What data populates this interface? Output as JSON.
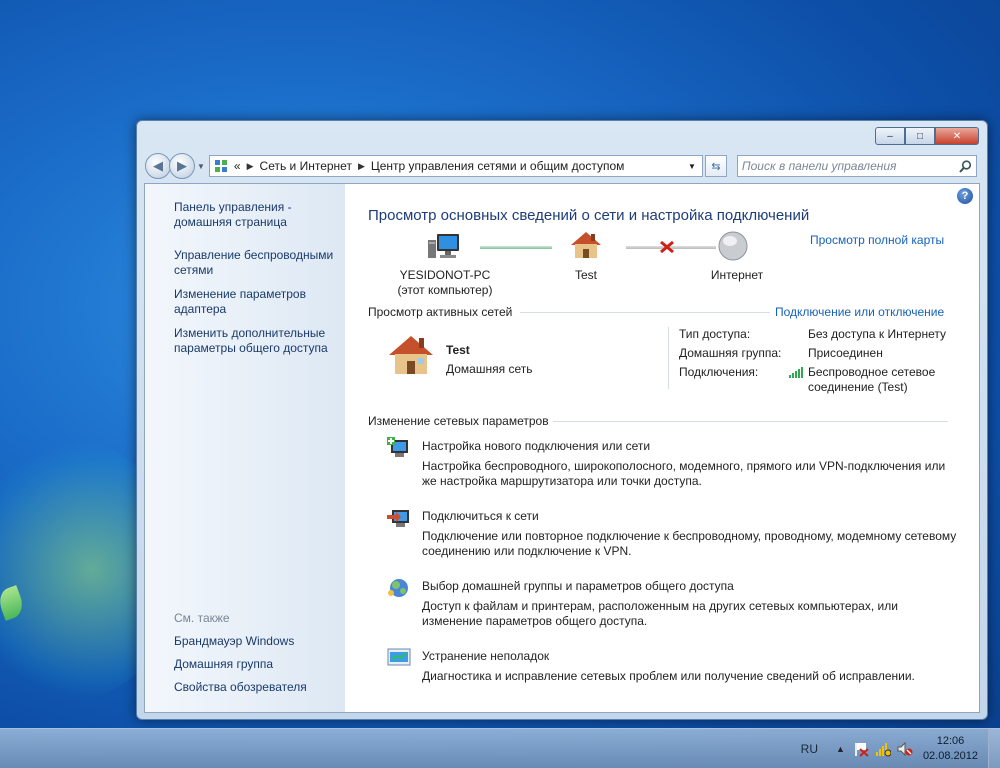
{
  "window": {
    "caption": {
      "minimize": "–",
      "maximize": "□",
      "close": "✕"
    },
    "breadcrumb": {
      "overflow": "«",
      "items": [
        "Сеть и Интернет",
        "Центр управления сетями и общим доступом"
      ]
    },
    "search_placeholder": "Поиск в панели управления"
  },
  "sidebar": {
    "items": [
      {
        "label": "Панель управления - домашняя страница"
      },
      {
        "label": "Управление беспроводными сетями"
      },
      {
        "label": "Изменение параметров адаптера"
      },
      {
        "label": "Изменить дополнительные параметры общего доступа"
      }
    ],
    "see_also": {
      "header": "См. также",
      "items": [
        "Брандмауэр Windows",
        "Домашняя группа",
        "Свойства обозревателя"
      ]
    }
  },
  "main": {
    "title": "Просмотр основных сведений о сети и настройка подключений",
    "full_map_link": "Просмотр полной карты",
    "map": {
      "computer_name": "YESIDONOT-PC",
      "computer_sub": "(этот компьютер)",
      "network_name": "Test",
      "internet_label": "Интернет"
    },
    "active": {
      "header": "Просмотр активных сетей",
      "connect_link": "Подключение или отключение",
      "network_name": "Test",
      "network_type": "Домашняя сеть",
      "access_type_label": "Тип доступа:",
      "access_type_value": "Без доступа к Интернету",
      "homegroup_label": "Домашняя группа:",
      "homegroup_value": "Присоединен",
      "connections_label": "Подключения:",
      "connections_value": "Беспроводное сетевое соединение (Test)"
    },
    "change": {
      "header": "Изменение сетевых параметров",
      "tasks": [
        {
          "title": "Настройка нового подключения или сети",
          "desc": "Настройка беспроводного, широкополосного, модемного, прямого или VPN-подключения или же настройка маршрутизатора или точки доступа."
        },
        {
          "title": "Подключиться к сети",
          "desc": "Подключение или повторное подключение к беспроводному, проводному, модемному сетевому соединению или подключение к VPN."
        },
        {
          "title": "Выбор домашней группы и параметров общего доступа",
          "desc": "Доступ к файлам и принтерам, расположенным на других сетевых компьютерах, или изменение параметров общего доступа."
        },
        {
          "title": "Устранение неполадок",
          "desc": "Диагностика и исправление сетевых проблем или получение сведений об исправлении."
        }
      ]
    }
  },
  "taskbar": {
    "language": "RU",
    "time": "12:06",
    "date": "02.08.2012"
  }
}
